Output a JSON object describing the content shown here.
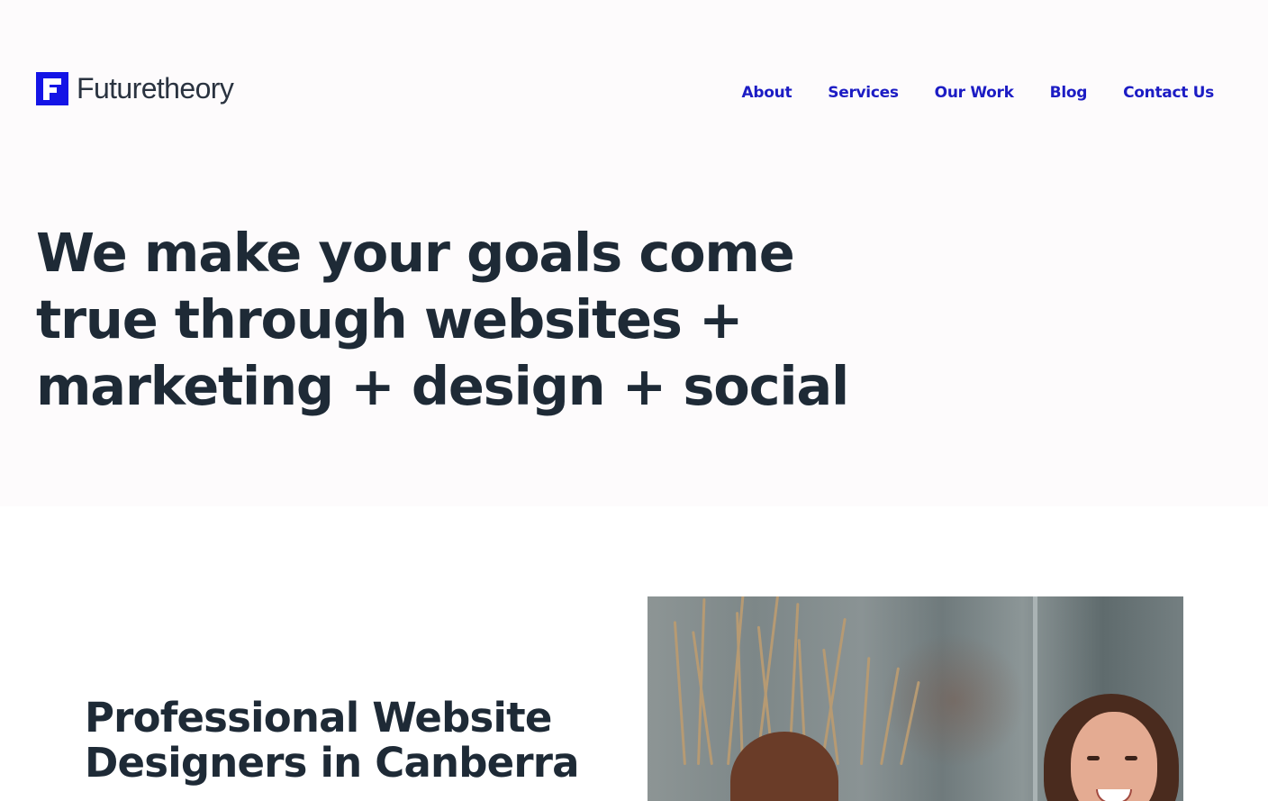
{
  "brand": {
    "name": "Futuretheory",
    "logo_icon": "futuretheory-f-logo-icon",
    "accent_color": "#1414e6"
  },
  "nav": {
    "items": [
      {
        "label": "About"
      },
      {
        "label": "Services"
      },
      {
        "label": "Our Work"
      },
      {
        "label": "Blog"
      },
      {
        "label": "Contact Us"
      }
    ],
    "link_color": "#1c1cc4"
  },
  "hero": {
    "headline": "We make your goals come true through websites + marketing + design + social"
  },
  "intro": {
    "title": "Professional Website Designers in Canberra"
  },
  "photo": {
    "description_icon": "team-photo-image"
  }
}
